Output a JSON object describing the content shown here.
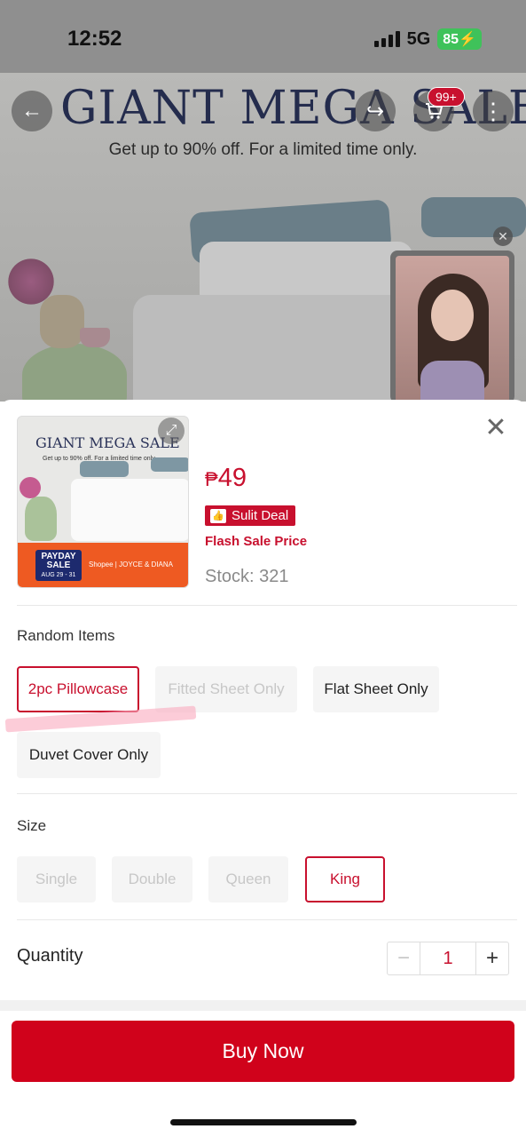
{
  "status_bar": {
    "time": "12:52",
    "network": "5G",
    "battery": "85"
  },
  "background": {
    "banner_title": "GIANT MEGA SALE",
    "banner_subtitle": "Get up to 90% off. For a limited time only.",
    "cart_badge": "99+",
    "icons": {
      "back": "back-arrow-icon",
      "share": "share-icon",
      "cart": "cart-icon",
      "more": "more-vertical-icon",
      "close_live": "close-icon"
    }
  },
  "sheet": {
    "thumbnail": {
      "title": "GIANT MEGA SALE",
      "subtitle": "Get up to 90% off. For a limited time only.",
      "payday_line1": "PAYDAY",
      "payday_line2": "SALE",
      "payday_dates": "AUG 29 - 31",
      "brands": "Shopee | JOYCE & DIANA"
    },
    "price": {
      "currency": "₱",
      "amount": "49"
    },
    "deal_badge": "Sulit Deal",
    "flash_label": "Flash Sale Price",
    "stock": "Stock: 321",
    "random_items": {
      "label": "Random Items",
      "options": [
        {
          "label": "2pc Pillowcase",
          "state": "selected"
        },
        {
          "label": "Fitted Sheet Only",
          "state": "disabled"
        },
        {
          "label": "Flat Sheet Only",
          "state": "available"
        },
        {
          "label": "Duvet Cover Only",
          "state": "available"
        }
      ]
    },
    "size": {
      "label": "Size",
      "options": [
        {
          "label": "Single",
          "state": "disabled"
        },
        {
          "label": "Double",
          "state": "disabled"
        },
        {
          "label": "Queen",
          "state": "disabled"
        },
        {
          "label": "King",
          "state": "selected"
        }
      ]
    },
    "quantity": {
      "label": "Quantity",
      "value": "1",
      "minus": "−",
      "plus": "+"
    },
    "buy_button": "Buy Now"
  },
  "colors": {
    "accent": "#c8102e",
    "buy_button": "#d0021b"
  }
}
